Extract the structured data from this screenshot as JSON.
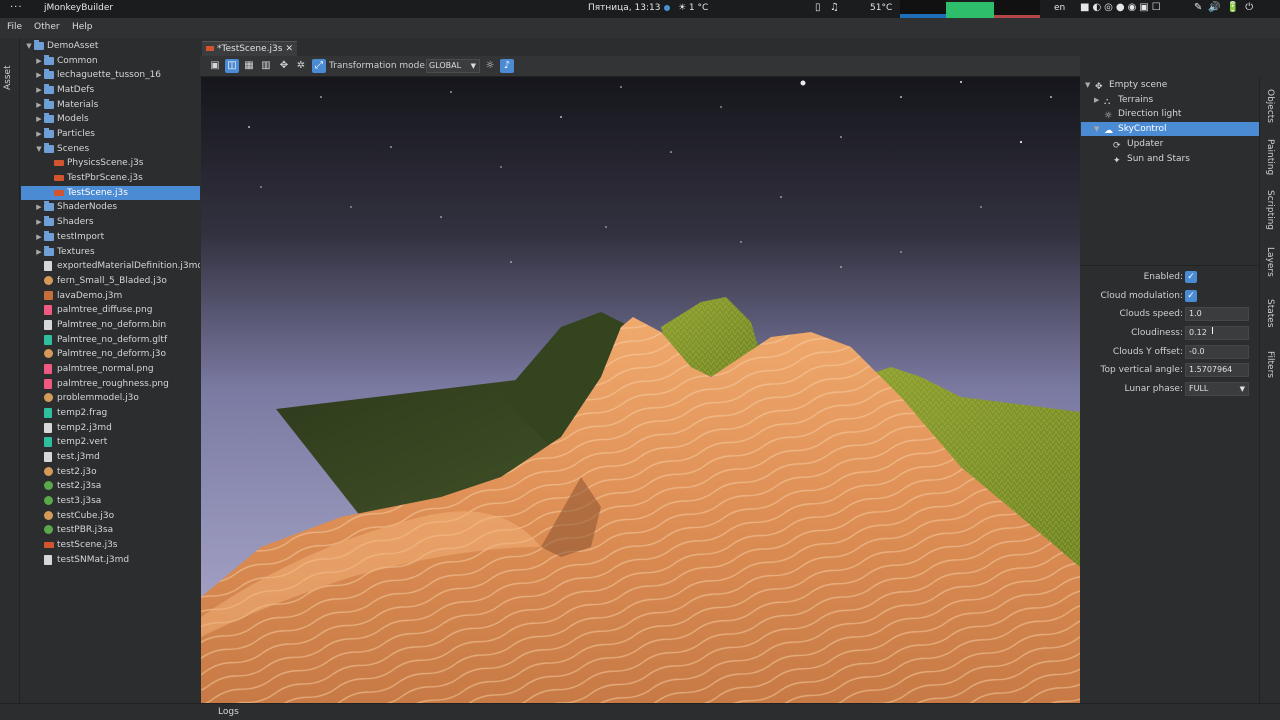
{
  "system": {
    "menu_glyph": "···",
    "app_name": "jMonkeyBuilder",
    "clock": "Пятница, 13:13",
    "weather": "☀ 1 °C",
    "temperature": "51°C",
    "language": "en"
  },
  "menu": {
    "file": "File",
    "other": "Other",
    "help": "Help"
  },
  "left_tab": "Asset",
  "asset_tree": [
    {
      "label": "DemoAsset",
      "icon": "folder",
      "level": 0,
      "arrow": "▼"
    },
    {
      "label": "Common",
      "icon": "folder",
      "level": 1,
      "arrow": "▶"
    },
    {
      "label": "lechaguette_tusson_16",
      "icon": "folder",
      "level": 1,
      "arrow": "▶"
    },
    {
      "label": "MatDefs",
      "icon": "folder",
      "level": 1,
      "arrow": "▶"
    },
    {
      "label": "Materials",
      "icon": "folder",
      "level": 1,
      "arrow": "▶"
    },
    {
      "label": "Models",
      "icon": "folder",
      "level": 1,
      "arrow": "▶"
    },
    {
      "label": "Particles",
      "icon": "folder",
      "level": 1,
      "arrow": "▶"
    },
    {
      "label": "Scenes",
      "icon": "folder",
      "level": 1,
      "arrow": "▼"
    },
    {
      "label": "PhysicsScene.j3s",
      "icon": "scene",
      "level": 2,
      "arrow": ""
    },
    {
      "label": "TestPbrScene.j3s",
      "icon": "scene",
      "level": 2,
      "arrow": ""
    },
    {
      "label": "TestScene.j3s",
      "icon": "scene",
      "level": 2,
      "arrow": "",
      "selected": true
    },
    {
      "label": "ShaderNodes",
      "icon": "folder",
      "level": 1,
      "arrow": "▶"
    },
    {
      "label": "Shaders",
      "icon": "folder",
      "level": 1,
      "arrow": "▶"
    },
    {
      "label": "testImport",
      "icon": "folder",
      "level": 1,
      "arrow": "▶"
    },
    {
      "label": "Textures",
      "icon": "folder",
      "level": 1,
      "arrow": "▶"
    },
    {
      "label": "exportedMaterialDefinition.j3md",
      "icon": "file",
      "level": 1,
      "arrow": ""
    },
    {
      "label": "fern_Small_5_Bladed.j3o",
      "icon": "model",
      "level": 1,
      "arrow": ""
    },
    {
      "label": "lavaDemo.j3m",
      "icon": "lava",
      "level": 1,
      "arrow": ""
    },
    {
      "label": "palmtree_diffuse.png",
      "icon": "img",
      "level": 1,
      "arrow": ""
    },
    {
      "label": "Palmtree_no_deform.bin",
      "icon": "file",
      "level": 1,
      "arrow": ""
    },
    {
      "label": "Palmtree_no_deform.gltf",
      "icon": "green",
      "level": 1,
      "arrow": ""
    },
    {
      "label": "Palmtree_no_deform.j3o",
      "icon": "model",
      "level": 1,
      "arrow": ""
    },
    {
      "label": "palmtree_normal.png",
      "icon": "img",
      "level": 1,
      "arrow": ""
    },
    {
      "label": "palmtree_roughness.png",
      "icon": "img",
      "level": 1,
      "arrow": ""
    },
    {
      "label": "problemmodel.j3o",
      "icon": "model",
      "level": 1,
      "arrow": ""
    },
    {
      "label": "temp2.frag",
      "icon": "green",
      "level": 1,
      "arrow": ""
    },
    {
      "label": "temp2.j3md",
      "icon": "file",
      "level": 1,
      "arrow": ""
    },
    {
      "label": "temp2.vert",
      "icon": "green",
      "level": 1,
      "arrow": ""
    },
    {
      "label": "test.j3md",
      "icon": "file",
      "level": 1,
      "arrow": ""
    },
    {
      "label": "test2.j3o",
      "icon": "model",
      "level": 1,
      "arrow": ""
    },
    {
      "label": "test2.j3sa",
      "icon": "anim",
      "level": 1,
      "arrow": ""
    },
    {
      "label": "test3.j3sa",
      "icon": "anim",
      "level": 1,
      "arrow": ""
    },
    {
      "label": "testCube.j3o",
      "icon": "model",
      "level": 1,
      "arrow": ""
    },
    {
      "label": "testPBR.j3sa",
      "icon": "anim",
      "level": 1,
      "arrow": ""
    },
    {
      "label": "testScene.j3s",
      "icon": "scene",
      "level": 1,
      "arrow": ""
    },
    {
      "label": "testSNMat.j3md",
      "icon": "file",
      "level": 1,
      "arrow": ""
    }
  ],
  "editor_tab": {
    "label": "*TestScene.j3s",
    "close": "✕"
  },
  "toolbar": {
    "transformation_label": "Transformation mode:",
    "transformation_value": "GLOBAL"
  },
  "scene_tree": [
    {
      "label": "Empty scene",
      "level": 0,
      "arrow": "▼",
      "icon": "✥"
    },
    {
      "label": "Terrains",
      "level": 1,
      "arrow": "▶",
      "icon": "⛬"
    },
    {
      "label": "Direction light",
      "level": 1,
      "arrow": "",
      "icon": "☼"
    },
    {
      "label": "SkyControl",
      "level": 1,
      "arrow": "▼",
      "icon": "☁",
      "selected": true
    },
    {
      "label": "Updater",
      "level": 2,
      "arrow": "",
      "icon": "⟳"
    },
    {
      "label": "Sun and Stars",
      "level": 2,
      "arrow": "",
      "icon": "✦"
    }
  ],
  "properties": {
    "enabled": {
      "label": "Enabled:",
      "checked": "✓"
    },
    "cloud_modulation": {
      "label": "Cloud modulation:",
      "checked": "✓"
    },
    "clouds_speed": {
      "label": "Clouds speed:",
      "value": "1.0"
    },
    "cloudiness": {
      "label": "Cloudiness:",
      "value": "0.12"
    },
    "clouds_y_offset": {
      "label": "Clouds Y offset:",
      "value": "-0.0"
    },
    "top_vertical_angle": {
      "label": "Top vertical angle:",
      "value": "1.5707964"
    },
    "lunar_phase": {
      "label": "Lunar phase:",
      "value": "FULL"
    }
  },
  "right_tabs": [
    "Objects",
    "Painting",
    "Scripting",
    "Layers",
    "States",
    "Filters"
  ],
  "status": {
    "logs": "Logs"
  },
  "colors": {
    "accent": "#4b8bd4",
    "sand": "#e0935a",
    "grass": "#8a9a2e",
    "sky_top": "#16161c",
    "sky_bottom": "#a7a6c9"
  }
}
